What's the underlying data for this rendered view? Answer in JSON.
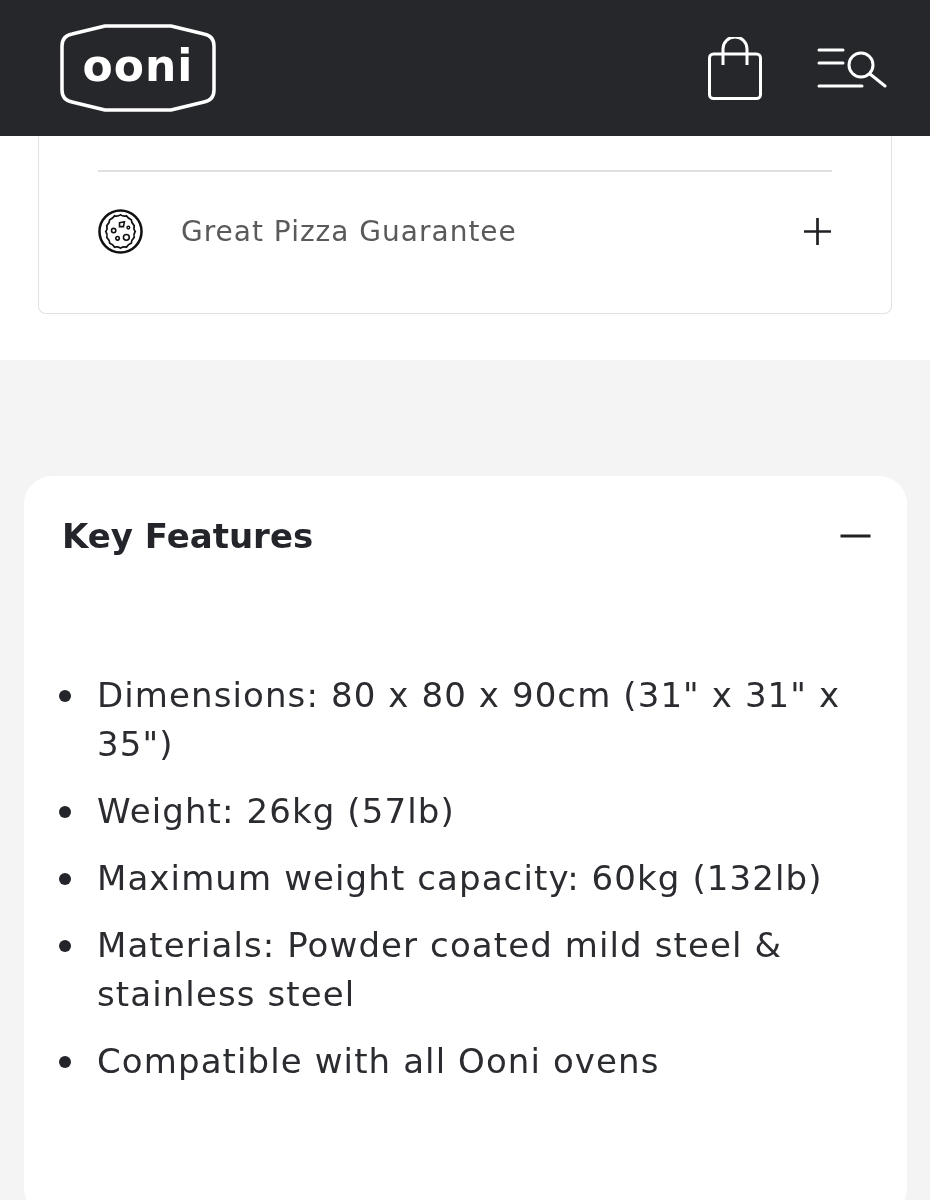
{
  "header": {
    "logo": "ooni"
  },
  "guarantee": {
    "title": "Great Pizza Guarantee",
    "expanded": false
  },
  "key_features": {
    "title": "Key Features",
    "expanded": true,
    "items": [
      "Dimensions: 80 x 80 x 90cm (31\" x 31\" x 35\")",
      "Weight: 26kg (57lb)",
      "Maximum weight capacity: 60kg (132lb)",
      "Materials: Powder coated mild steel & stainless steel",
      "Compatible with all Ooni ovens"
    ]
  }
}
